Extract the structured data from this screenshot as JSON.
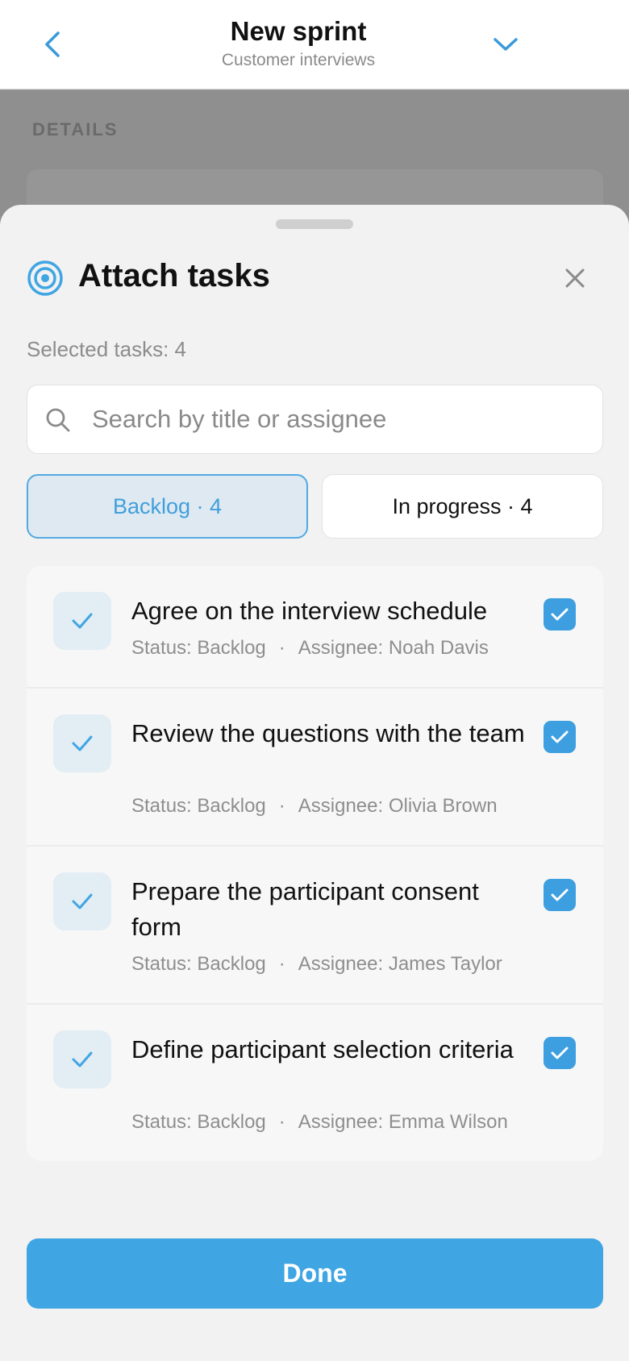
{
  "header": {
    "title": "New sprint",
    "subtitle": "Customer interviews",
    "back_icon": "chevron-left-icon",
    "expand_icon": "chevron-down-icon"
  },
  "background": {
    "section_heading": "DETAILS"
  },
  "sheet": {
    "icon": "target-icon",
    "title": "Attach tasks",
    "close_icon": "close-icon",
    "selected_label": "Selected tasks: 4",
    "search": {
      "placeholder": "Search by title or assignee",
      "value": ""
    },
    "tabs": [
      {
        "label": "Backlog · 4",
        "selected": true
      },
      {
        "label": "In progress · 4",
        "selected": false
      }
    ],
    "tasks": [
      {
        "title": "Agree on the interview schedule",
        "status": "Status: Backlog",
        "separator": "·",
        "assignee": "Assignee: Noah Davis",
        "checked": true
      },
      {
        "title": "Review the questions with the team",
        "status": "Status: Backlog",
        "separator": "·",
        "assignee": "Assignee: Olivia Brown",
        "checked": true
      },
      {
        "title": "Prepare the participant consent form",
        "status": "Status: Backlog",
        "separator": "·",
        "assignee": "Assignee: James Taylor",
        "checked": true
      },
      {
        "title": "Define participant selection criteria",
        "status": "Status: Backlog",
        "separator": "·",
        "assignee": "Assignee: Emma Wilson",
        "checked": true
      }
    ],
    "done_label": "Done"
  },
  "colors": {
    "accent": "#3fa5e3",
    "tab_selected_bg": "#dfe9f1",
    "muted_text": "#8e8e8e"
  }
}
